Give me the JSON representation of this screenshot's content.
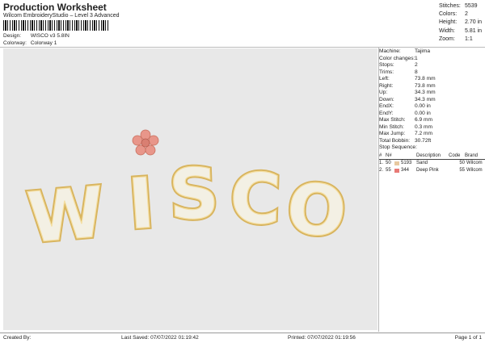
{
  "header": {
    "title": "Production Worksheet",
    "subtitle": "Wilcom EmbroideryStudio – Level 3 Advanced",
    "design_label": "Design:",
    "design_value": "WISCO v3 5.8IN",
    "colorway_label": "Colorway:",
    "colorway_value": "Colorway 1"
  },
  "stats": [
    {
      "label": "Stitches:",
      "value": "5539"
    },
    {
      "label": "Colors:",
      "value": "2"
    },
    {
      "label": "Height:",
      "value": "2.70 in"
    },
    {
      "label": "Width:",
      "value": "5.81 in"
    },
    {
      "label": "Zoom:",
      "value": "1:1"
    }
  ],
  "details": [
    {
      "label": "Machine:",
      "value": "Tajima"
    },
    {
      "label": "Color changes:",
      "value": "1"
    },
    {
      "label": "Stops:",
      "value": "2"
    },
    {
      "label": "Trims:",
      "value": "8"
    },
    {
      "label": "Left:",
      "value": "73.8 mm"
    },
    {
      "label": "Right:",
      "value": "73.8 mm"
    },
    {
      "label": "Up:",
      "value": "34.3 mm"
    },
    {
      "label": "Down:",
      "value": "34.3 mm"
    },
    {
      "label": "EndX:",
      "value": "0.00 in"
    },
    {
      "label": "EndY:",
      "value": "0.00 in"
    },
    {
      "label": "Max Stitch:",
      "value": "6.9 mm"
    },
    {
      "label": "Min Stitch:",
      "value": "0.3 mm"
    },
    {
      "label": "Max Jump:",
      "value": "7.2 mm"
    },
    {
      "label": "Total Bobbin:",
      "value": "30.72ft"
    }
  ],
  "stop_sequence": {
    "title": "Stop Sequence:",
    "headers": [
      "#",
      "N#",
      "Description",
      "Code",
      "Brand"
    ],
    "rows": [
      {
        "idx": "1.",
        "n": "50",
        "code_num": "5193",
        "desc": "Sand",
        "code": "50",
        "brand": "Wilcom",
        "color": "#e8c9a0"
      },
      {
        "idx": "2.",
        "n": "55",
        "code_num": "344",
        "desc": "Deep Pink",
        "code": "55",
        "brand": "Wilcom",
        "color": "#e87a76"
      }
    ]
  },
  "design": {
    "text": "WISCO",
    "outline_color": "#e0c070",
    "fill_color": "#f3f0e4",
    "flower_color": "#e8968a"
  },
  "footer": {
    "created_by": "Created By:",
    "last_saved": "Last Saved: 07/07/2022 01:19:42",
    "printed": "Printed: 07/07/2022 01:19:56",
    "page": "Page 1 of 1"
  }
}
